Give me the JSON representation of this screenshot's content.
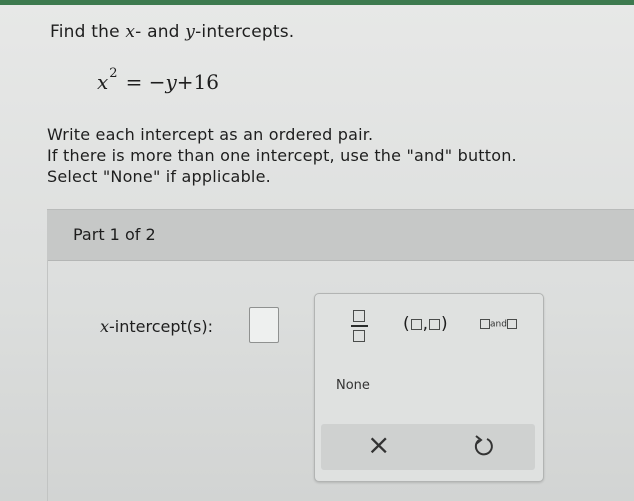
{
  "question": {
    "prefix": "Find the ",
    "var_x": "x",
    "middle": "- and ",
    "var_y": "y",
    "suffix": "-intercepts."
  },
  "equation": {
    "base": "x",
    "exponent": "2",
    "rhs_eq": "=",
    "rhs_minus": "−",
    "rhs_var": "y",
    "rhs_rest": "+16"
  },
  "instructions": [
    "Write each intercept as an ordered pair.",
    "If there is more than one intercept, use the \"and\" button.",
    "Select \"None\" if applicable."
  ],
  "part": {
    "label": "Part 1 of 2"
  },
  "answer": {
    "var": "x",
    "label_rest": "-intercept(s):",
    "value": ""
  },
  "palette": {
    "pair_open": "(",
    "pair_comma": ",",
    "pair_close": ")",
    "and_label": "and",
    "none_label": "None",
    "clear_symbol": "×"
  }
}
